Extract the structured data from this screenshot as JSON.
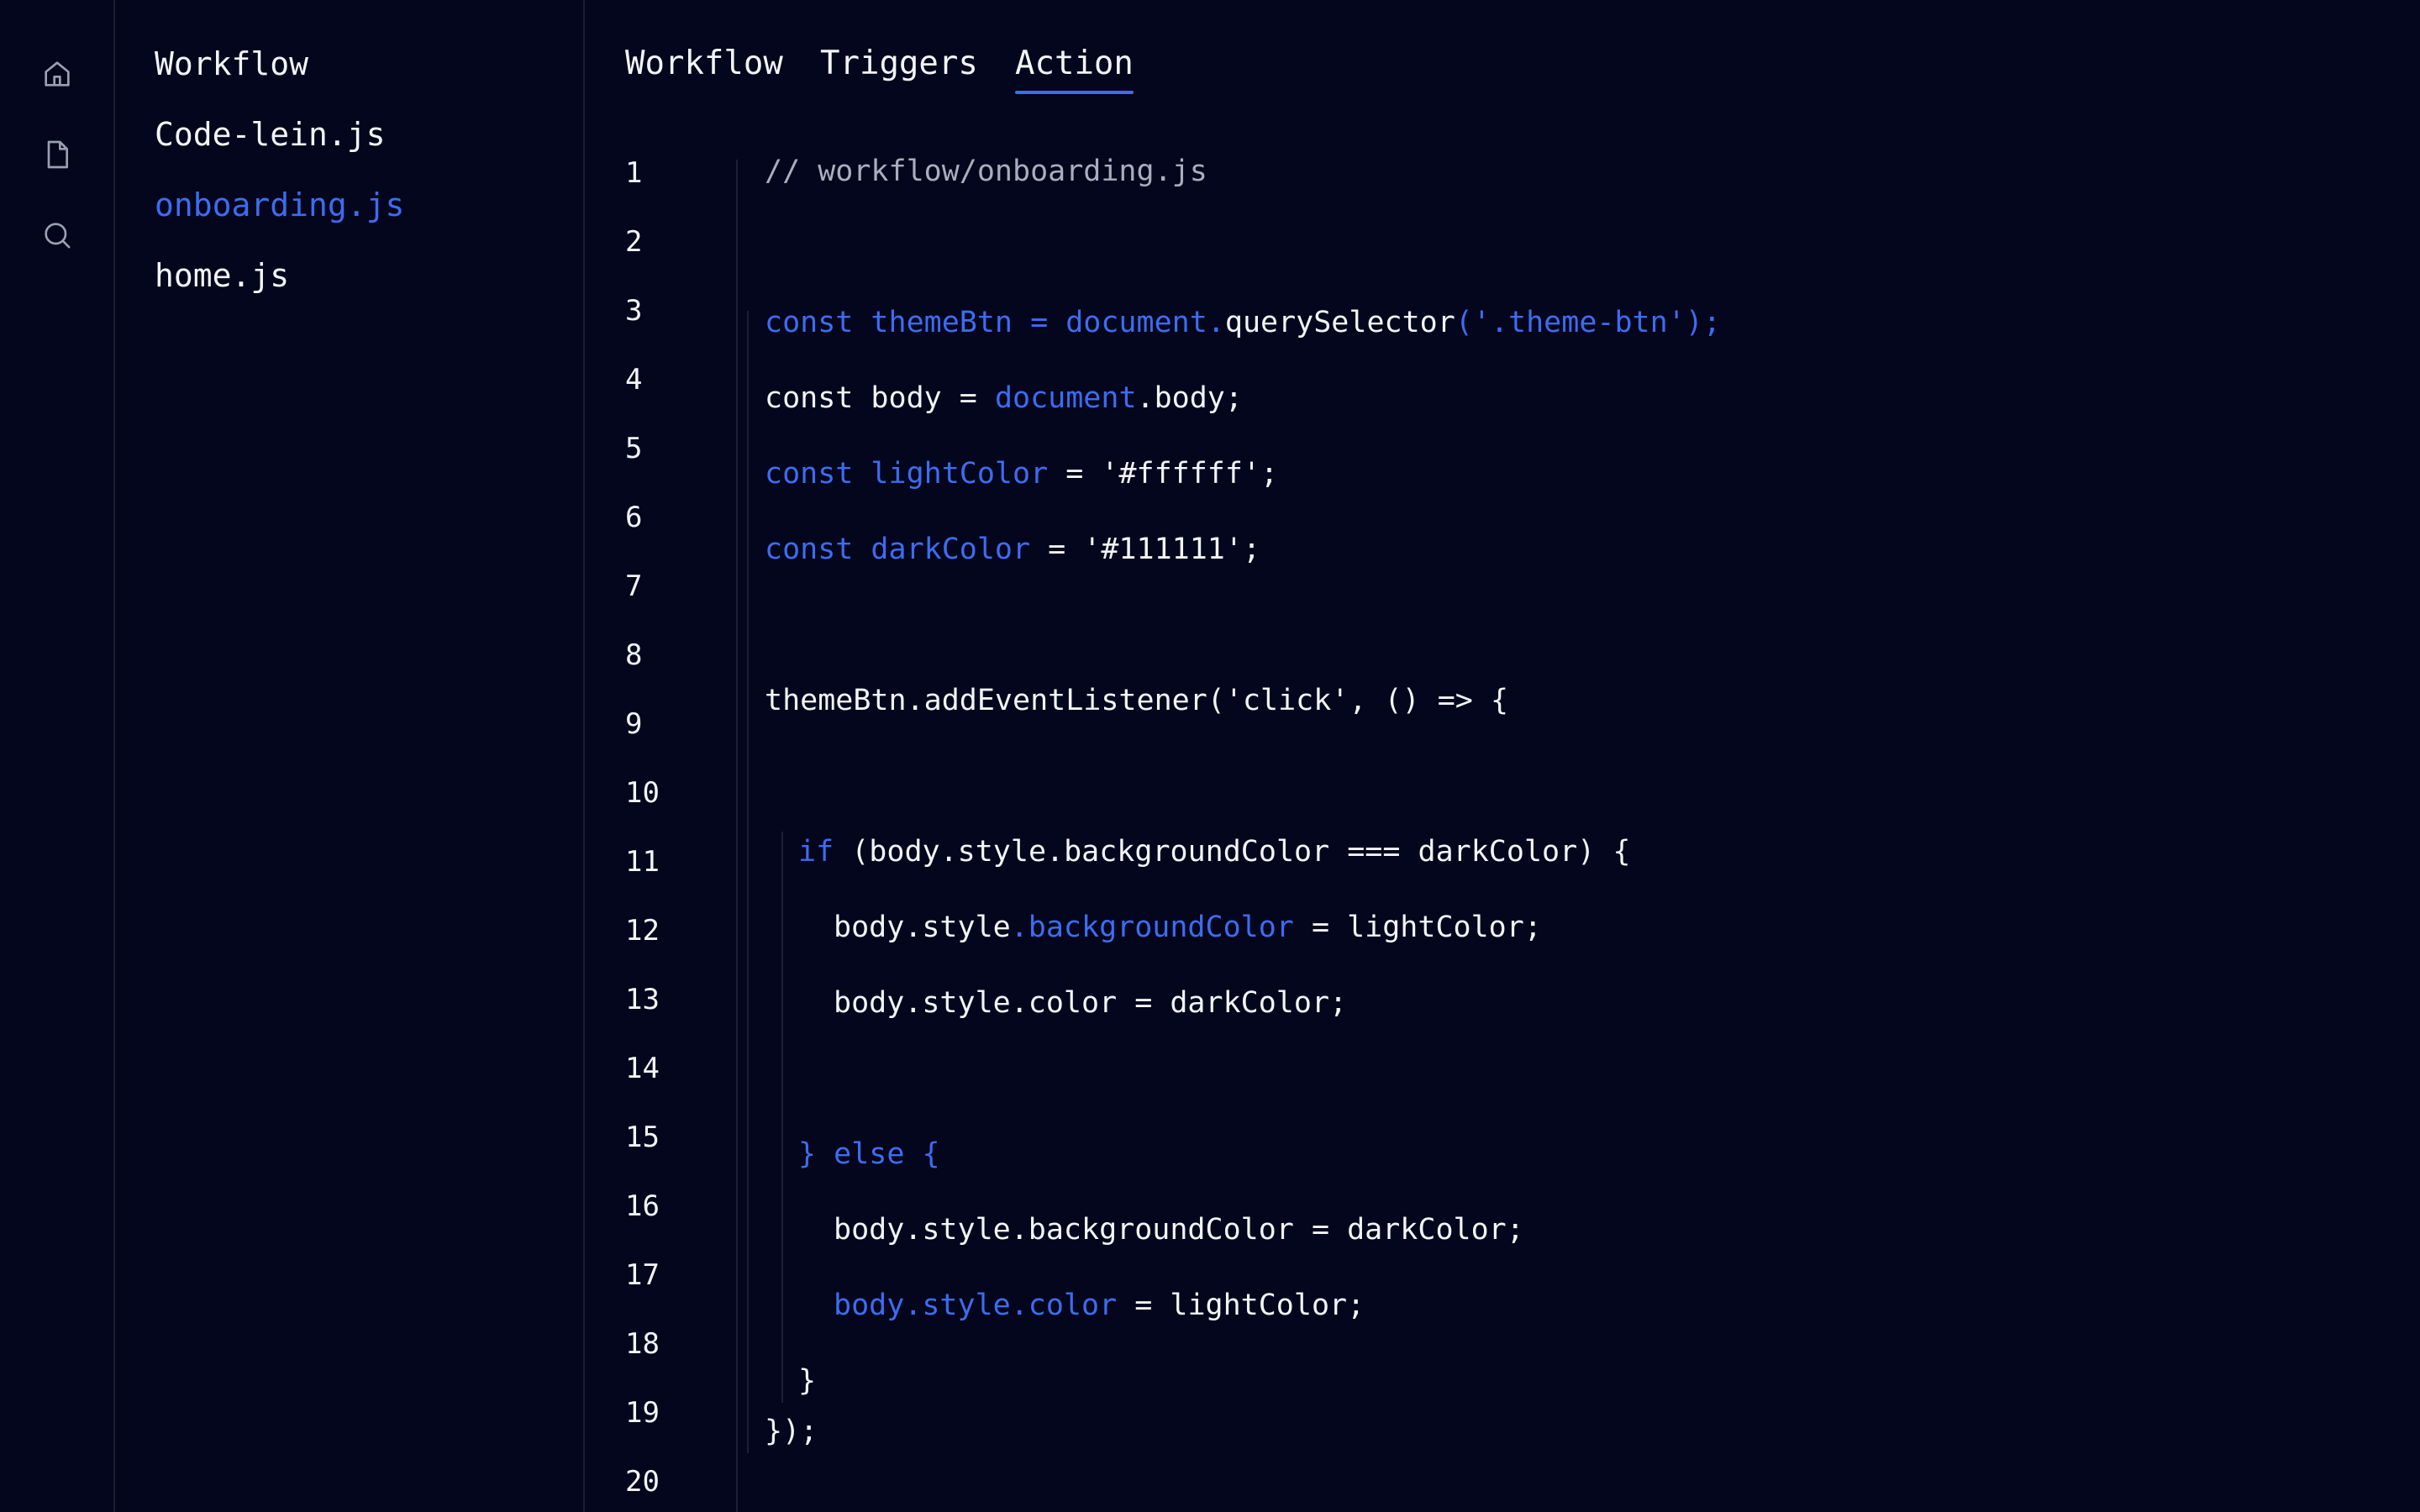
{
  "activity_bar": {
    "icons": [
      "home-icon",
      "file-icon",
      "search-icon"
    ]
  },
  "explorer": {
    "items": [
      {
        "label": "Workflow",
        "active": false
      },
      {
        "label": "Code-lein.js",
        "active": false
      },
      {
        "label": "onboarding.js",
        "active": true
      },
      {
        "label": "home.js",
        "active": false
      }
    ]
  },
  "tabs": [
    {
      "label": "Workflow",
      "active": false
    },
    {
      "label": "Triggers",
      "active": false
    },
    {
      "label": "Action",
      "active": true
    }
  ],
  "editor": {
    "line_numbers": [
      "1",
      "2",
      "3",
      "4",
      "5",
      "6",
      "7",
      "8",
      "9",
      "10",
      "11",
      "12",
      "13",
      "14",
      "15",
      "16",
      "17",
      "18",
      "19",
      "20"
    ],
    "code_lines": [
      [
        {
          "t": "// workflow/onboarding.js",
          "c": "cm"
        }
      ],
      [
        {
          "t": "const themeBtn = document.",
          "c": "kw"
        },
        {
          "t": "querySelector",
          "c": "tx"
        },
        {
          "t": "('.theme-btn');",
          "c": "kw"
        }
      ],
      [
        {
          "t": "const body = ",
          "c": "tx"
        },
        {
          "t": "document",
          "c": "kw"
        },
        {
          "t": ".body;",
          "c": "tx"
        }
      ],
      [
        {
          "t": "const lightColor",
          "c": "kw"
        },
        {
          "t": " = '#ffffff';",
          "c": "tx"
        }
      ],
      [
        {
          "t": "const darkColor",
          "c": "kw"
        },
        {
          "t": " = '#111111';",
          "c": "tx"
        }
      ],
      [
        {
          "t": "themeBtn.addEventListener('click', () => {",
          "c": "tx"
        }
      ],
      [
        {
          "t": "if",
          "c": "kw"
        },
        {
          "t": " (body.style.backgroundColor === darkColor) {",
          "c": "tx"
        }
      ],
      [
        {
          "t": "body.style",
          "c": "tx"
        },
        {
          "t": ".backgroundColor",
          "c": "kw"
        },
        {
          "t": " = lightColor;",
          "c": "tx"
        }
      ],
      [
        {
          "t": "body.style.color = darkColor;",
          "c": "tx"
        }
      ],
      [
        {
          "t": "} else {",
          "c": "kw"
        }
      ],
      [
        {
          "t": "body.style.backgroundColor = darkColor;",
          "c": "tx"
        }
      ],
      [
        {
          "t": "body.style.color",
          "c": "kw"
        },
        {
          "t": " = lightColor;",
          "c": "tx"
        }
      ],
      [
        {
          "t": "}",
          "c": "tx"
        }
      ],
      [
        {
          "t": "});",
          "c": "tx"
        }
      ]
    ]
  },
  "colors": {
    "background": "#03061c",
    "accent": "#3d6cf0",
    "text": "#f2f4f8",
    "comment": "#a9adbd"
  }
}
